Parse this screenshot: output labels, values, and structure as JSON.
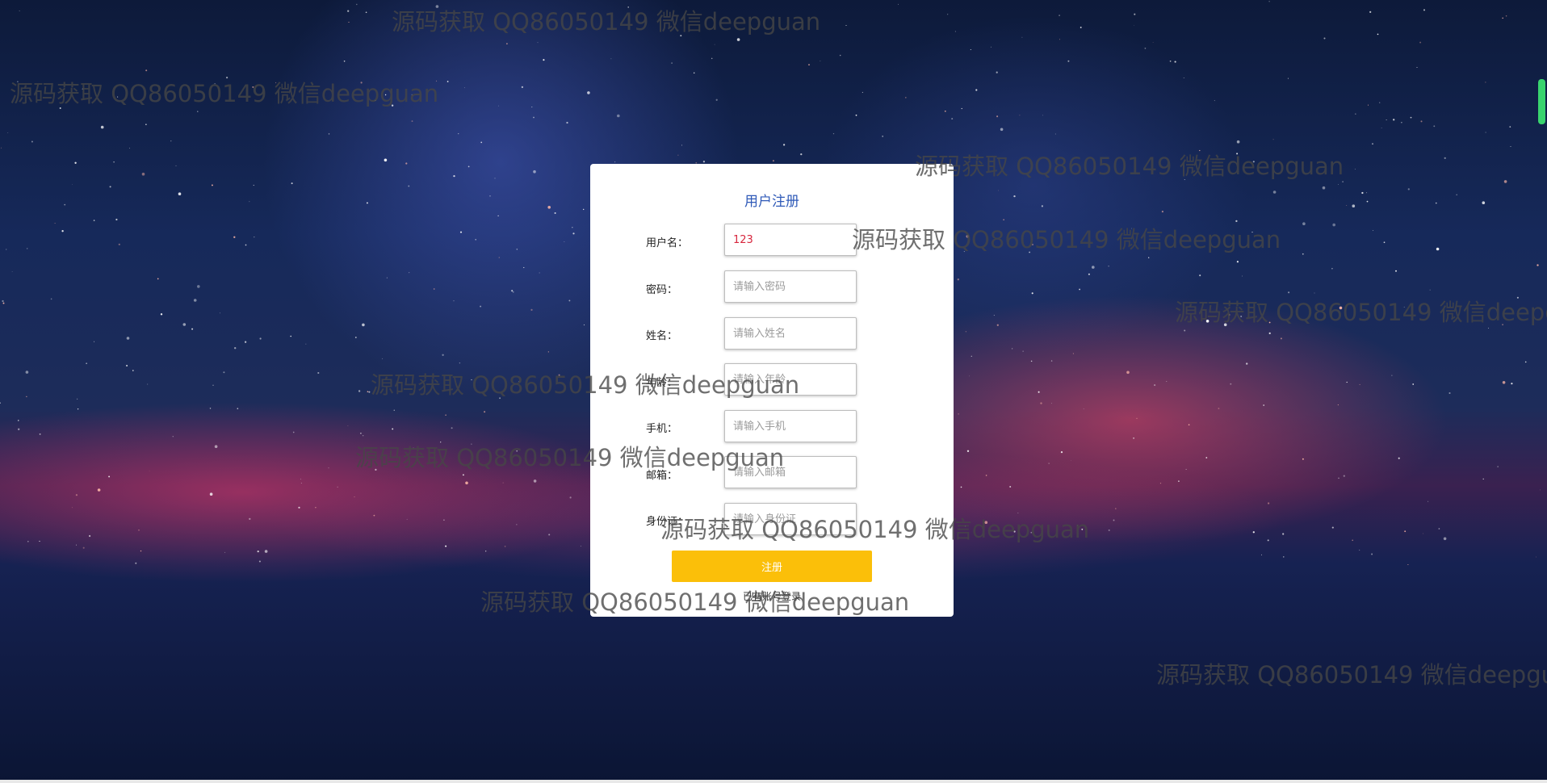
{
  "form": {
    "title": "用户注册",
    "fields": [
      {
        "label": "用户名：",
        "value": "123",
        "placeholder": ""
      },
      {
        "label": "密码：",
        "value": "",
        "placeholder": "请输入密码"
      },
      {
        "label": "姓名：",
        "value": "",
        "placeholder": "请输入姓名"
      },
      {
        "label": "年龄：",
        "value": "",
        "placeholder": "请输入年龄"
      },
      {
        "label": "手机：",
        "value": "",
        "placeholder": "请输入手机"
      },
      {
        "label": "邮箱：",
        "value": "",
        "placeholder": "请输入邮箱"
      },
      {
        "label": "身份证：",
        "value": "",
        "placeholder": "请输入身份证"
      }
    ],
    "register_label": "注册",
    "login_link": "已有账号登录"
  },
  "watermark": "源码获取 QQ86050149 微信deepguan",
  "colors": {
    "title": "#2f5ab8",
    "button": "#fbbf09",
    "input_value": "#d7263d"
  }
}
